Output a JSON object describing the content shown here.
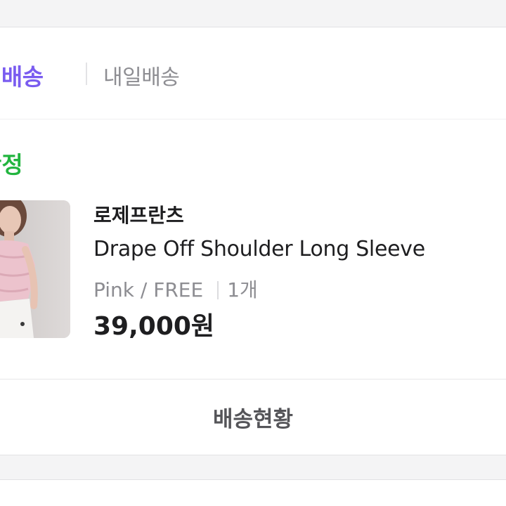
{
  "delivery": {
    "primary_label": "새벽배송",
    "primary_label_visible_part": "진배송",
    "secondary_label": "내일배송",
    "accent_color": "#7a5cf0"
  },
  "order": {
    "status_label": "구매확정",
    "status_label_visible_part": "확정",
    "status_color": "#22b53f",
    "item": {
      "thumbnail_icon": "product-photo",
      "brand": "로제프란츠",
      "name": "Drape Off Shoulder Long Sleeve",
      "option": "Pink / FREE",
      "quantity": "1개",
      "price": "39,000원"
    }
  },
  "actions": {
    "track_label": "배송현황"
  }
}
